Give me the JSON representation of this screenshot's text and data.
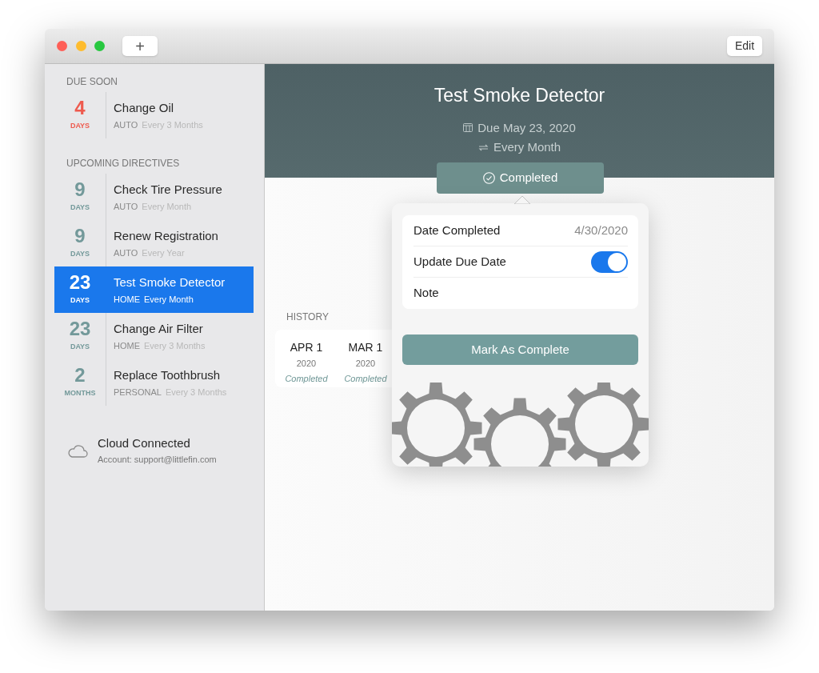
{
  "toolbar": {
    "add_button": "+",
    "edit_button": "Edit"
  },
  "sidebar": {
    "sections": [
      {
        "title": "DUE SOON",
        "items": [
          {
            "count": "4",
            "unit": "DAYS",
            "title": "Change Oil",
            "category": "AUTO",
            "frequency": "Every 3 Months",
            "color": "#ee5a4e",
            "selected": false
          }
        ]
      },
      {
        "title": "UPCOMING DIRECTIVES",
        "items": [
          {
            "count": "9",
            "unit": "DAYS",
            "title": "Check Tire Pressure",
            "category": "AUTO",
            "frequency": "Every Month",
            "color": "#73999a",
            "selected": false
          },
          {
            "count": "9",
            "unit": "DAYS",
            "title": "Renew Registration",
            "category": "AUTO",
            "frequency": "Every Year",
            "color": "#73999a",
            "selected": false
          },
          {
            "count": "23",
            "unit": "DAYS",
            "title": "Test Smoke Detector",
            "category": "HOME",
            "frequency": "Every Month",
            "selected": true
          },
          {
            "count": "23",
            "unit": "DAYS",
            "title": "Change Air Filter",
            "category": "HOME",
            "frequency": "Every 3 Months",
            "color": "#73999a",
            "selected": false
          },
          {
            "count": "2",
            "unit": "MONTHS",
            "title": "Replace Toothbrush",
            "category": "PERSONAL",
            "frequency": "Every 3 Months",
            "color": "#73999a",
            "selected": false
          }
        ]
      }
    ],
    "cloud": {
      "title": "Cloud Connected",
      "account": "Account: support@littlefin.com"
    }
  },
  "detail": {
    "title": "Test Smoke Detector",
    "due": "Due May 23, 2020",
    "repeat": "Every Month",
    "status_button": "Completed",
    "history": {
      "title": "HISTORY",
      "entries": [
        {
          "date": "APR 1",
          "year": "2020",
          "status": "Completed"
        },
        {
          "date": "MAR 1",
          "year": "2020",
          "status": "Completed"
        }
      ]
    }
  },
  "popover": {
    "date_label": "Date Completed",
    "date_value": "4/30/2020",
    "update_label": "Update Due Date",
    "update_on": true,
    "note_label": "Note",
    "submit": "Mark As Complete"
  }
}
